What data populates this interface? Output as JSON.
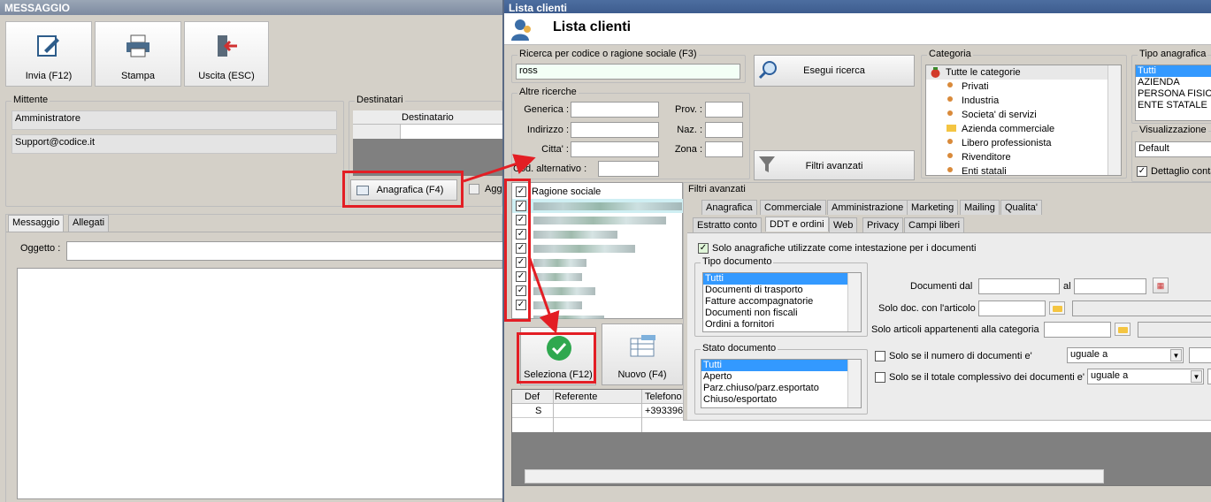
{
  "left": {
    "title": "MESSAGGIO",
    "buttons": [
      {
        "label": "Invia (F12)",
        "icon": "edit-icon"
      },
      {
        "label": "Stampa",
        "icon": "printer-icon"
      },
      {
        "label": "Uscita (ESC)",
        "icon": "exit-icon"
      }
    ],
    "mittente_label": "Mittente",
    "mittente_name": "Amministratore",
    "mittente_email": "Support@codice.it",
    "destinatari_label": "Destinatari",
    "dest_col": "Destinatario",
    "anagrafica_button": "Anagrafica (F4)",
    "agg_button": "Agg",
    "tabs": [
      "Messaggio",
      "Allegati"
    ],
    "oggetto_label": "Oggetto :"
  },
  "right": {
    "window_title": "Lista clienti",
    "header_title": "Lista clienti",
    "search_label": "Ricerca per codice o ragione sociale (F3)",
    "search_value": "ross",
    "search_button": "Esegui ricerca",
    "altre_label": "Altre ricerche",
    "fields": {
      "generica": "Generica :",
      "indirizzo": "Indirizzo :",
      "citta": "Citta' :",
      "cod": "Cod. alternativo :",
      "prov": "Prov. :",
      "naz": "Naz. :",
      "zona": "Zona :"
    },
    "filtri_button": "Filtri avanzati",
    "categoria_label": "Categoria",
    "categories": [
      "Tutte le categorie",
      "Privati",
      "Industria",
      "Societa' di servizi",
      "Azienda commerciale",
      "Libero professionista",
      "Rivenditore",
      "Enti statali"
    ],
    "tipo_label": "Tipo anagrafica",
    "tipo_items": [
      "Tutti",
      "AZIENDA",
      "PERSONA FISICA",
      "ENTE STATALE"
    ],
    "visual_label": "Visualizzazione",
    "visual_value": "Default",
    "dettaglio_label": "Dettaglio conta",
    "ragione_header": "Ragione sociale",
    "seleziona_button": "Seleziona (F12)",
    "nuovo_button": "Nuovo (F4)",
    "grid_cols": [
      "Def",
      "Referente",
      "Telefono"
    ],
    "grid_row": {
      "def": "S",
      "ref": "",
      "tel": "+393396"
    },
    "filtri_title": "Filtri avanzati",
    "tabs_row1": [
      "Anagrafica",
      "Commerciale",
      "Amministrazione",
      "Marketing",
      "Mailing",
      "Qualita'"
    ],
    "tabs_row2": [
      "Estratto conto",
      "DDT e ordini",
      "Web",
      "Privacy",
      "Campi liberi"
    ],
    "solo_anag": "Solo anagrafiche utilizzate come intestazione per i documenti",
    "tipo_doc_label": "Tipo documento",
    "tipo_doc_items": [
      "Tutti",
      "Documenti di trasporto",
      "Fatture accompagnatorie",
      "Documenti non fiscali",
      "Ordini a fornitori"
    ],
    "stato_doc_label": "Stato documento",
    "stato_doc_items": [
      "Tutti",
      "Aperto",
      "Parz.chiuso/parz.esportato",
      "Chiuso/esportato"
    ],
    "doc_dal": "Documenti dal",
    "al": "al",
    "solo_art": "Solo doc. con l'articolo",
    "solo_cat": "Solo articoli appartenenti alla categoria",
    "solo_num": "Solo se il numero di documenti e'",
    "solo_tot": "Solo se il totale complessivo dei documenti e'",
    "uguale": "uguale a"
  }
}
